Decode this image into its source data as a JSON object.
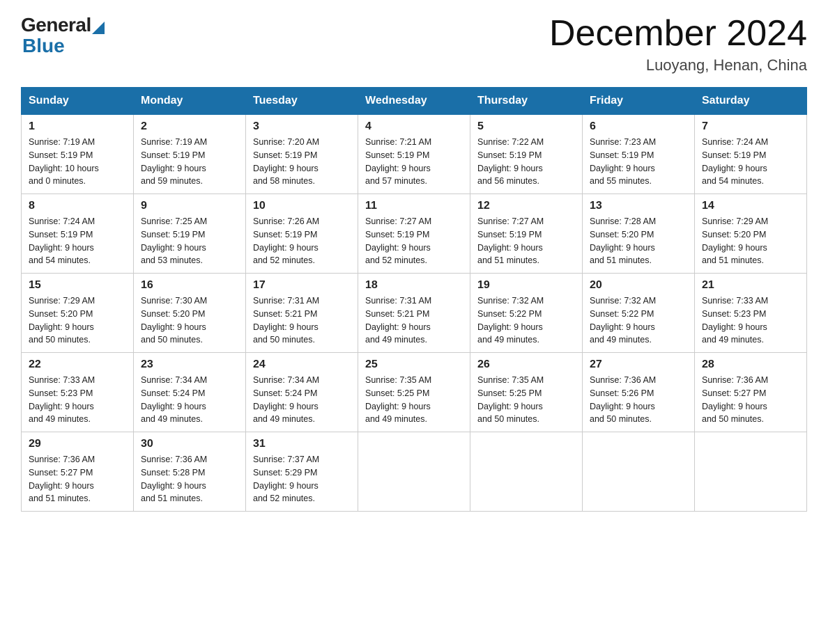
{
  "header": {
    "logo_general": "General",
    "logo_blue": "Blue",
    "title": "December 2024",
    "location": "Luoyang, Henan, China"
  },
  "days_of_week": [
    "Sunday",
    "Monday",
    "Tuesday",
    "Wednesday",
    "Thursday",
    "Friday",
    "Saturday"
  ],
  "weeks": [
    [
      {
        "day": "1",
        "sunrise": "7:19 AM",
        "sunset": "5:19 PM",
        "daylight": "10 hours and 0 minutes."
      },
      {
        "day": "2",
        "sunrise": "7:19 AM",
        "sunset": "5:19 PM",
        "daylight": "9 hours and 59 minutes."
      },
      {
        "day": "3",
        "sunrise": "7:20 AM",
        "sunset": "5:19 PM",
        "daylight": "9 hours and 58 minutes."
      },
      {
        "day": "4",
        "sunrise": "7:21 AM",
        "sunset": "5:19 PM",
        "daylight": "9 hours and 57 minutes."
      },
      {
        "day": "5",
        "sunrise": "7:22 AM",
        "sunset": "5:19 PM",
        "daylight": "9 hours and 56 minutes."
      },
      {
        "day": "6",
        "sunrise": "7:23 AM",
        "sunset": "5:19 PM",
        "daylight": "9 hours and 55 minutes."
      },
      {
        "day": "7",
        "sunrise": "7:24 AM",
        "sunset": "5:19 PM",
        "daylight": "9 hours and 54 minutes."
      }
    ],
    [
      {
        "day": "8",
        "sunrise": "7:24 AM",
        "sunset": "5:19 PM",
        "daylight": "9 hours and 54 minutes."
      },
      {
        "day": "9",
        "sunrise": "7:25 AM",
        "sunset": "5:19 PM",
        "daylight": "9 hours and 53 minutes."
      },
      {
        "day": "10",
        "sunrise": "7:26 AM",
        "sunset": "5:19 PM",
        "daylight": "9 hours and 52 minutes."
      },
      {
        "day": "11",
        "sunrise": "7:27 AM",
        "sunset": "5:19 PM",
        "daylight": "9 hours and 52 minutes."
      },
      {
        "day": "12",
        "sunrise": "7:27 AM",
        "sunset": "5:19 PM",
        "daylight": "9 hours and 51 minutes."
      },
      {
        "day": "13",
        "sunrise": "7:28 AM",
        "sunset": "5:20 PM",
        "daylight": "9 hours and 51 minutes."
      },
      {
        "day": "14",
        "sunrise": "7:29 AM",
        "sunset": "5:20 PM",
        "daylight": "9 hours and 51 minutes."
      }
    ],
    [
      {
        "day": "15",
        "sunrise": "7:29 AM",
        "sunset": "5:20 PM",
        "daylight": "9 hours and 50 minutes."
      },
      {
        "day": "16",
        "sunrise": "7:30 AM",
        "sunset": "5:20 PM",
        "daylight": "9 hours and 50 minutes."
      },
      {
        "day": "17",
        "sunrise": "7:31 AM",
        "sunset": "5:21 PM",
        "daylight": "9 hours and 50 minutes."
      },
      {
        "day": "18",
        "sunrise": "7:31 AM",
        "sunset": "5:21 PM",
        "daylight": "9 hours and 49 minutes."
      },
      {
        "day": "19",
        "sunrise": "7:32 AM",
        "sunset": "5:22 PM",
        "daylight": "9 hours and 49 minutes."
      },
      {
        "day": "20",
        "sunrise": "7:32 AM",
        "sunset": "5:22 PM",
        "daylight": "9 hours and 49 minutes."
      },
      {
        "day": "21",
        "sunrise": "7:33 AM",
        "sunset": "5:23 PM",
        "daylight": "9 hours and 49 minutes."
      }
    ],
    [
      {
        "day": "22",
        "sunrise": "7:33 AM",
        "sunset": "5:23 PM",
        "daylight": "9 hours and 49 minutes."
      },
      {
        "day": "23",
        "sunrise": "7:34 AM",
        "sunset": "5:24 PM",
        "daylight": "9 hours and 49 minutes."
      },
      {
        "day": "24",
        "sunrise": "7:34 AM",
        "sunset": "5:24 PM",
        "daylight": "9 hours and 49 minutes."
      },
      {
        "day": "25",
        "sunrise": "7:35 AM",
        "sunset": "5:25 PM",
        "daylight": "9 hours and 49 minutes."
      },
      {
        "day": "26",
        "sunrise": "7:35 AM",
        "sunset": "5:25 PM",
        "daylight": "9 hours and 50 minutes."
      },
      {
        "day": "27",
        "sunrise": "7:36 AM",
        "sunset": "5:26 PM",
        "daylight": "9 hours and 50 minutes."
      },
      {
        "day": "28",
        "sunrise": "7:36 AM",
        "sunset": "5:27 PM",
        "daylight": "9 hours and 50 minutes."
      }
    ],
    [
      {
        "day": "29",
        "sunrise": "7:36 AM",
        "sunset": "5:27 PM",
        "daylight": "9 hours and 51 minutes."
      },
      {
        "day": "30",
        "sunrise": "7:36 AM",
        "sunset": "5:28 PM",
        "daylight": "9 hours and 51 minutes."
      },
      {
        "day": "31",
        "sunrise": "7:37 AM",
        "sunset": "5:29 PM",
        "daylight": "9 hours and 52 minutes."
      },
      null,
      null,
      null,
      null
    ]
  ],
  "labels": {
    "sunrise": "Sunrise:",
    "sunset": "Sunset:",
    "daylight": "Daylight:"
  }
}
